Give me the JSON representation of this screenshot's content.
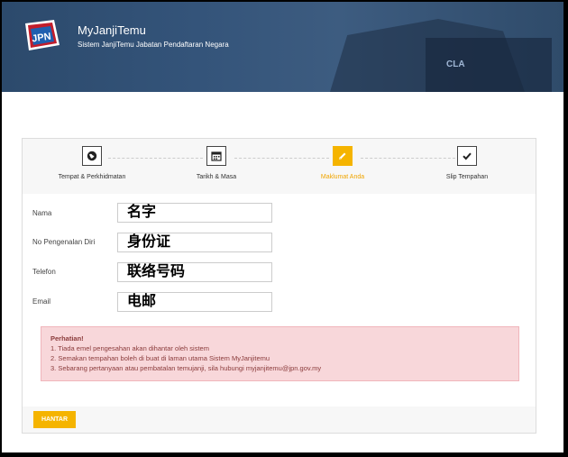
{
  "header": {
    "app_title": "MyJanjiTemu",
    "app_subtitle": "Sistem JanjiTemu Jabatan Pendaftaran Negara",
    "logo_text": "JPN",
    "bg_color": "#34547a"
  },
  "steps": [
    {
      "label": "Tempat & Perkhidmatan",
      "icon": "globe-icon",
      "active": false
    },
    {
      "label": "Tarikh & Masa",
      "icon": "calendar-icon",
      "active": false
    },
    {
      "label": "Maklumat Anda",
      "icon": "pencil-icon",
      "active": true
    },
    {
      "label": "Slip Tempahan",
      "icon": "check-icon",
      "active": false
    }
  ],
  "form": {
    "name": {
      "label": "Nama",
      "value": "名字"
    },
    "id": {
      "label": "No Pengenalan Diri",
      "value": "身份证"
    },
    "phone": {
      "label": "Telefon",
      "value": "联络号码"
    },
    "email": {
      "label": "Email",
      "value": "电邮"
    }
  },
  "alert": {
    "title": "Perhatian!",
    "lines": [
      "1. Tiada emel pengesahan akan dihantar oleh sistem",
      "2. Semakan tempahan boleh di buat di laman utama Sistem MyJanjitemu",
      "3. Sebarang pertanyaan atau pembatalan temujanji, sila hubungi myjanjitemu@jpn.gov.my"
    ]
  },
  "submit_label": "HANTAR",
  "accent_color": "#f5b400"
}
